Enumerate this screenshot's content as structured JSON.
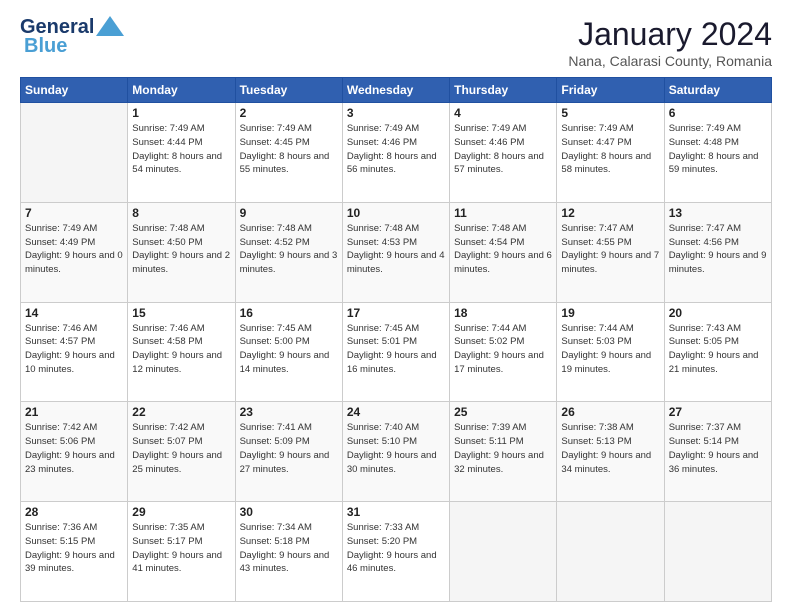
{
  "logo": {
    "line1": "General",
    "line2": "Blue"
  },
  "header": {
    "title": "January 2024",
    "subtitle": "Nana, Calarasi County, Romania"
  },
  "days_of_week": [
    "Sunday",
    "Monday",
    "Tuesday",
    "Wednesday",
    "Thursday",
    "Friday",
    "Saturday"
  ],
  "weeks": [
    [
      {
        "day": "",
        "empty": true
      },
      {
        "day": "1",
        "sunrise": "7:49 AM",
        "sunset": "4:44 PM",
        "daylight": "8 hours and 54 minutes."
      },
      {
        "day": "2",
        "sunrise": "7:49 AM",
        "sunset": "4:45 PM",
        "daylight": "8 hours and 55 minutes."
      },
      {
        "day": "3",
        "sunrise": "7:49 AM",
        "sunset": "4:46 PM",
        "daylight": "8 hours and 56 minutes."
      },
      {
        "day": "4",
        "sunrise": "7:49 AM",
        "sunset": "4:46 PM",
        "daylight": "8 hours and 57 minutes."
      },
      {
        "day": "5",
        "sunrise": "7:49 AM",
        "sunset": "4:47 PM",
        "daylight": "8 hours and 58 minutes."
      },
      {
        "day": "6",
        "sunrise": "7:49 AM",
        "sunset": "4:48 PM",
        "daylight": "8 hours and 59 minutes."
      }
    ],
    [
      {
        "day": "7",
        "sunrise": "7:49 AM",
        "sunset": "4:49 PM",
        "daylight": "9 hours and 0 minutes."
      },
      {
        "day": "8",
        "sunrise": "7:48 AM",
        "sunset": "4:50 PM",
        "daylight": "9 hours and 2 minutes."
      },
      {
        "day": "9",
        "sunrise": "7:48 AM",
        "sunset": "4:52 PM",
        "daylight": "9 hours and 3 minutes."
      },
      {
        "day": "10",
        "sunrise": "7:48 AM",
        "sunset": "4:53 PM",
        "daylight": "9 hours and 4 minutes."
      },
      {
        "day": "11",
        "sunrise": "7:48 AM",
        "sunset": "4:54 PM",
        "daylight": "9 hours and 6 minutes."
      },
      {
        "day": "12",
        "sunrise": "7:47 AM",
        "sunset": "4:55 PM",
        "daylight": "9 hours and 7 minutes."
      },
      {
        "day": "13",
        "sunrise": "7:47 AM",
        "sunset": "4:56 PM",
        "daylight": "9 hours and 9 minutes."
      }
    ],
    [
      {
        "day": "14",
        "sunrise": "7:46 AM",
        "sunset": "4:57 PM",
        "daylight": "9 hours and 10 minutes."
      },
      {
        "day": "15",
        "sunrise": "7:46 AM",
        "sunset": "4:58 PM",
        "daylight": "9 hours and 12 minutes."
      },
      {
        "day": "16",
        "sunrise": "7:45 AM",
        "sunset": "5:00 PM",
        "daylight": "9 hours and 14 minutes."
      },
      {
        "day": "17",
        "sunrise": "7:45 AM",
        "sunset": "5:01 PM",
        "daylight": "9 hours and 16 minutes."
      },
      {
        "day": "18",
        "sunrise": "7:44 AM",
        "sunset": "5:02 PM",
        "daylight": "9 hours and 17 minutes."
      },
      {
        "day": "19",
        "sunrise": "7:44 AM",
        "sunset": "5:03 PM",
        "daylight": "9 hours and 19 minutes."
      },
      {
        "day": "20",
        "sunrise": "7:43 AM",
        "sunset": "5:05 PM",
        "daylight": "9 hours and 21 minutes."
      }
    ],
    [
      {
        "day": "21",
        "sunrise": "7:42 AM",
        "sunset": "5:06 PM",
        "daylight": "9 hours and 23 minutes."
      },
      {
        "day": "22",
        "sunrise": "7:42 AM",
        "sunset": "5:07 PM",
        "daylight": "9 hours and 25 minutes."
      },
      {
        "day": "23",
        "sunrise": "7:41 AM",
        "sunset": "5:09 PM",
        "daylight": "9 hours and 27 minutes."
      },
      {
        "day": "24",
        "sunrise": "7:40 AM",
        "sunset": "5:10 PM",
        "daylight": "9 hours and 30 minutes."
      },
      {
        "day": "25",
        "sunrise": "7:39 AM",
        "sunset": "5:11 PM",
        "daylight": "9 hours and 32 minutes."
      },
      {
        "day": "26",
        "sunrise": "7:38 AM",
        "sunset": "5:13 PM",
        "daylight": "9 hours and 34 minutes."
      },
      {
        "day": "27",
        "sunrise": "7:37 AM",
        "sunset": "5:14 PM",
        "daylight": "9 hours and 36 minutes."
      }
    ],
    [
      {
        "day": "28",
        "sunrise": "7:36 AM",
        "sunset": "5:15 PM",
        "daylight": "9 hours and 39 minutes."
      },
      {
        "day": "29",
        "sunrise": "7:35 AM",
        "sunset": "5:17 PM",
        "daylight": "9 hours and 41 minutes."
      },
      {
        "day": "30",
        "sunrise": "7:34 AM",
        "sunset": "5:18 PM",
        "daylight": "9 hours and 43 minutes."
      },
      {
        "day": "31",
        "sunrise": "7:33 AM",
        "sunset": "5:20 PM",
        "daylight": "9 hours and 46 minutes."
      },
      {
        "day": "",
        "empty": true
      },
      {
        "day": "",
        "empty": true
      },
      {
        "day": "",
        "empty": true
      }
    ]
  ]
}
